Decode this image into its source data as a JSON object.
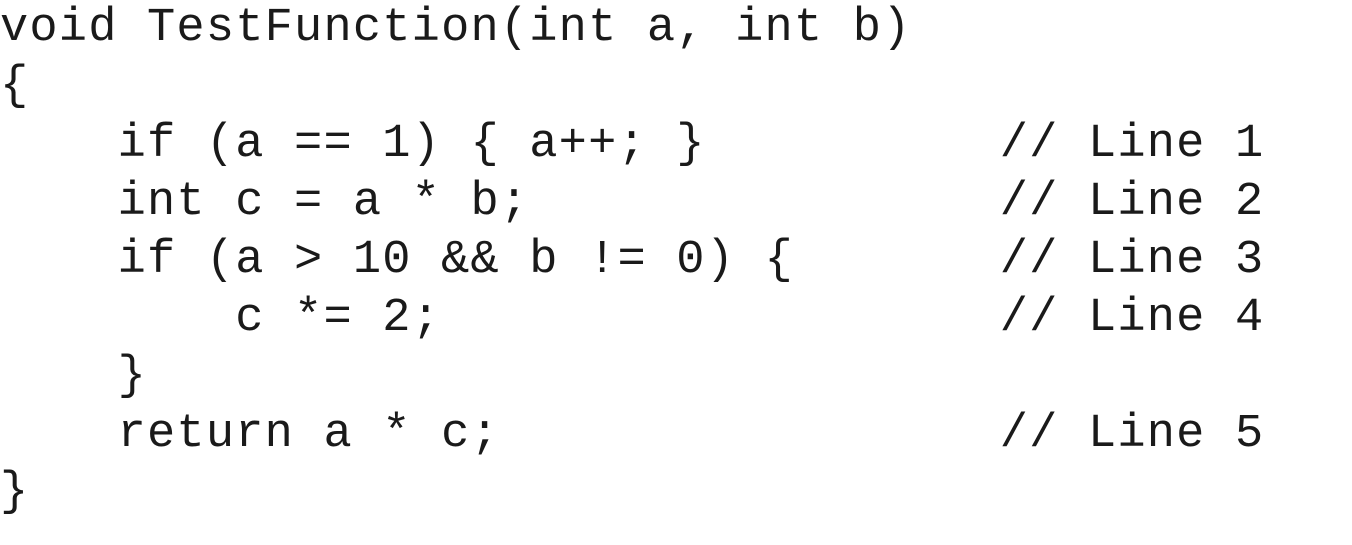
{
  "code": {
    "lines": [
      "void TestFunction(int a, int b)",
      "{",
      "    if (a == 1) { a++; }          // Line 1",
      "    int c = a * b;                // Line 2",
      "    if (a > 10 && b != 0) {       // Line 3",
      "        c *= 2;                   // Line 4",
      "    }",
      "    return a * c;                 // Line 5",
      "}"
    ]
  }
}
